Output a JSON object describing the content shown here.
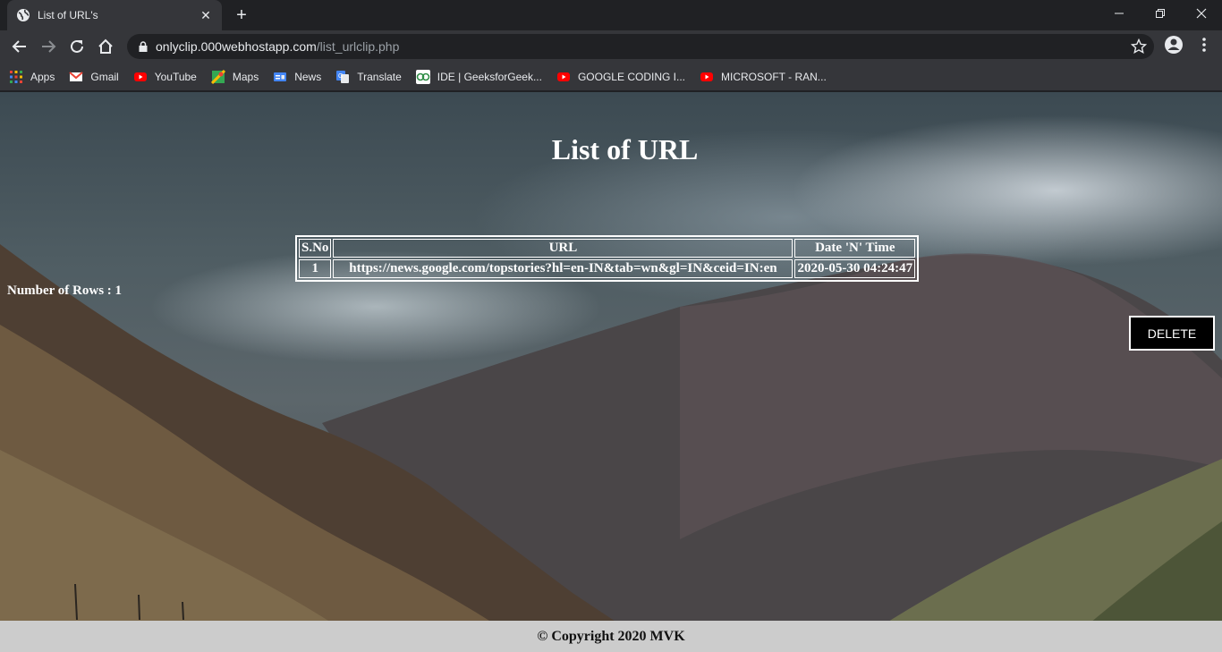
{
  "browser": {
    "tab_title": "List of URL's",
    "close_symbol": "✕",
    "new_tab_symbol": "+",
    "url_host": "onlyclip.000webhostapp.com",
    "url_path": "/list_urlclip.php"
  },
  "bookmarks": [
    {
      "label": "Apps",
      "icon": "apps-grid-icon",
      "color": "#4285f4"
    },
    {
      "label": "Gmail",
      "icon": "gmail-icon",
      "color": "#ea4335"
    },
    {
      "label": "YouTube",
      "icon": "youtube-icon",
      "color": "#ff0000"
    },
    {
      "label": "Maps",
      "icon": "maps-icon",
      "color": "#34a853"
    },
    {
      "label": "News",
      "icon": "news-icon",
      "color": "#4285f4"
    },
    {
      "label": "Translate",
      "icon": "translate-icon",
      "color": "#4285f4"
    },
    {
      "label": "IDE | GeeksforGeek...",
      "icon": "geeksforgeeks-icon",
      "color": "#2f8d46"
    },
    {
      "label": "GOOGLE CODING I...",
      "icon": "youtube-icon",
      "color": "#ff0000"
    },
    {
      "label": "MICROSOFT - RAN...",
      "icon": "youtube-icon",
      "color": "#ff0000"
    }
  ],
  "page": {
    "title": "List of URL",
    "table": {
      "headers": [
        "S.No",
        "URL",
        "Date 'N' Time"
      ],
      "rows": [
        [
          "1",
          "https://news.google.com/topstories?hl=en-IN&tab=wn&gl=IN&ceid=IN:en",
          "2020-05-30 04:24:47"
        ]
      ]
    },
    "row_count_text": "Number of Rows : 1",
    "delete_label": "DELETE",
    "footer_text": "© Copyright 2020 MVK"
  }
}
